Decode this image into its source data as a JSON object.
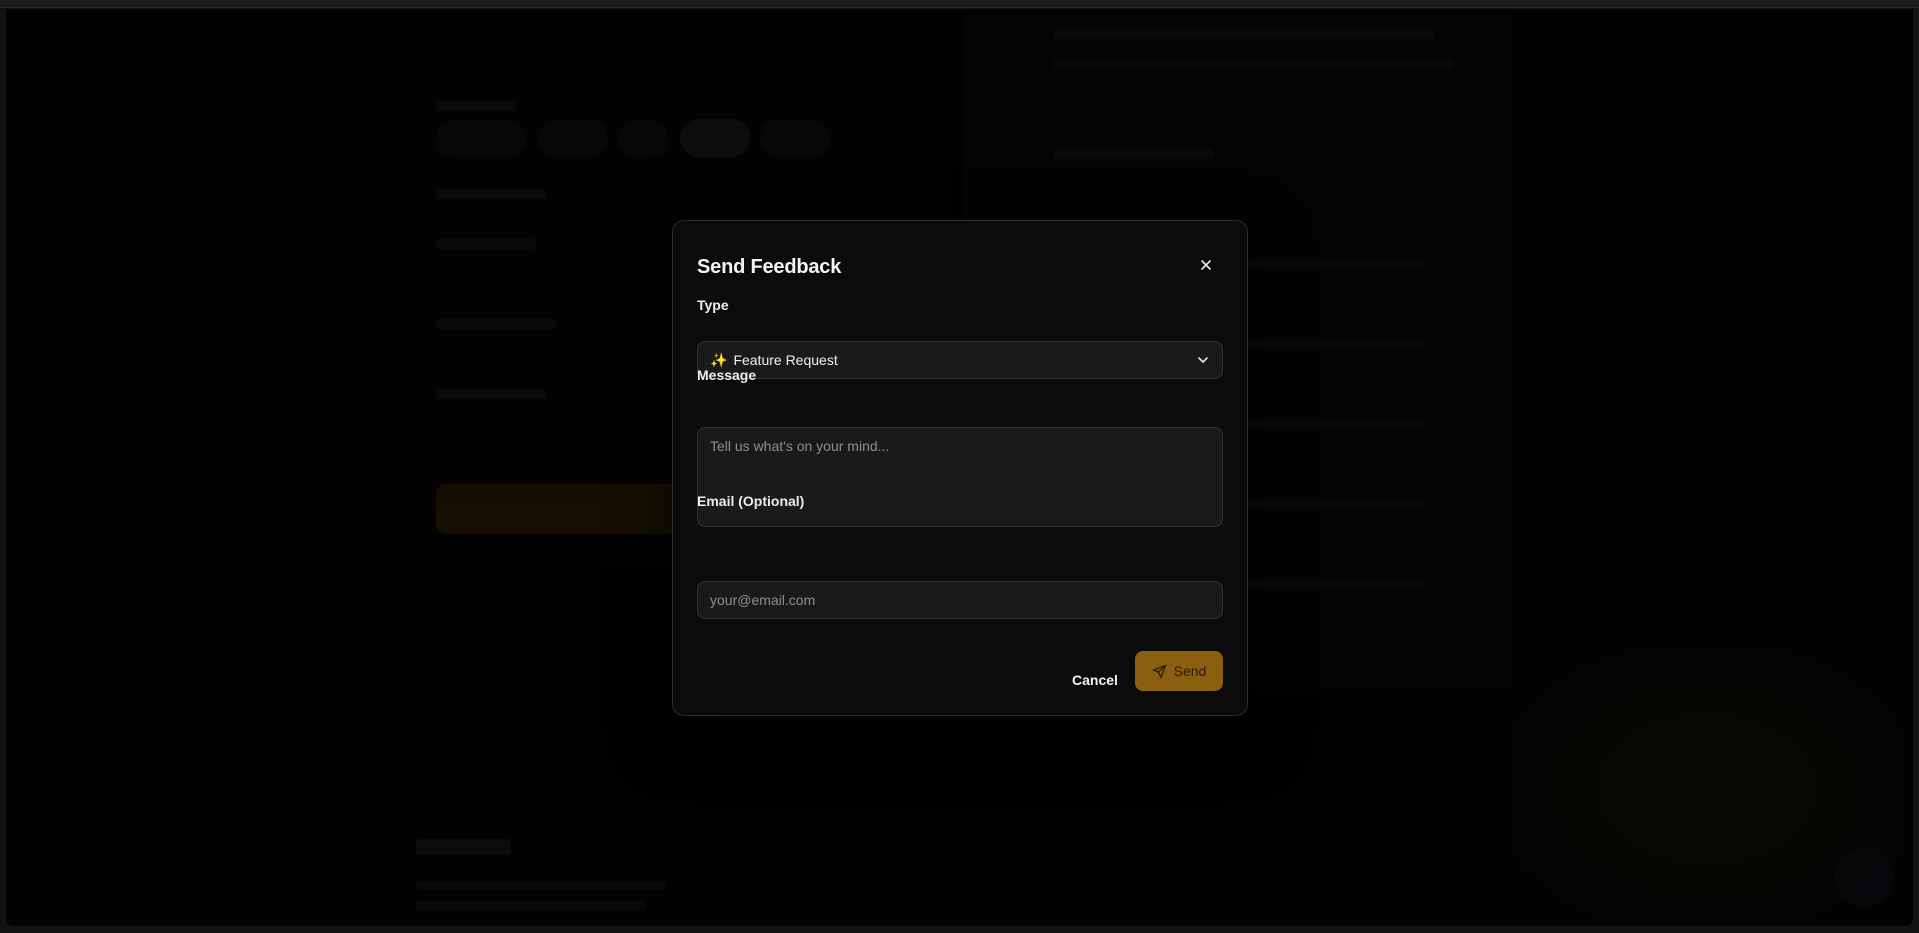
{
  "modal": {
    "title": "Send Feedback",
    "close_icon": "close-icon",
    "type": {
      "label": "Type",
      "selected_icon": "✨",
      "selected_value": "Feature Request",
      "chevron_icon": "chevron-down-icon"
    },
    "message": {
      "label": "Message",
      "placeholder": "Tell us what's on your mind..."
    },
    "email": {
      "label": "Email (Optional)",
      "placeholder": "your@email.com"
    },
    "actions": {
      "cancel_label": "Cancel",
      "send_label": "Send",
      "send_icon": "send-icon"
    }
  },
  "colors": {
    "accent": "#8a5f10",
    "modal_bg": "#0b0b0b",
    "field_bg": "#1a1a1a"
  }
}
